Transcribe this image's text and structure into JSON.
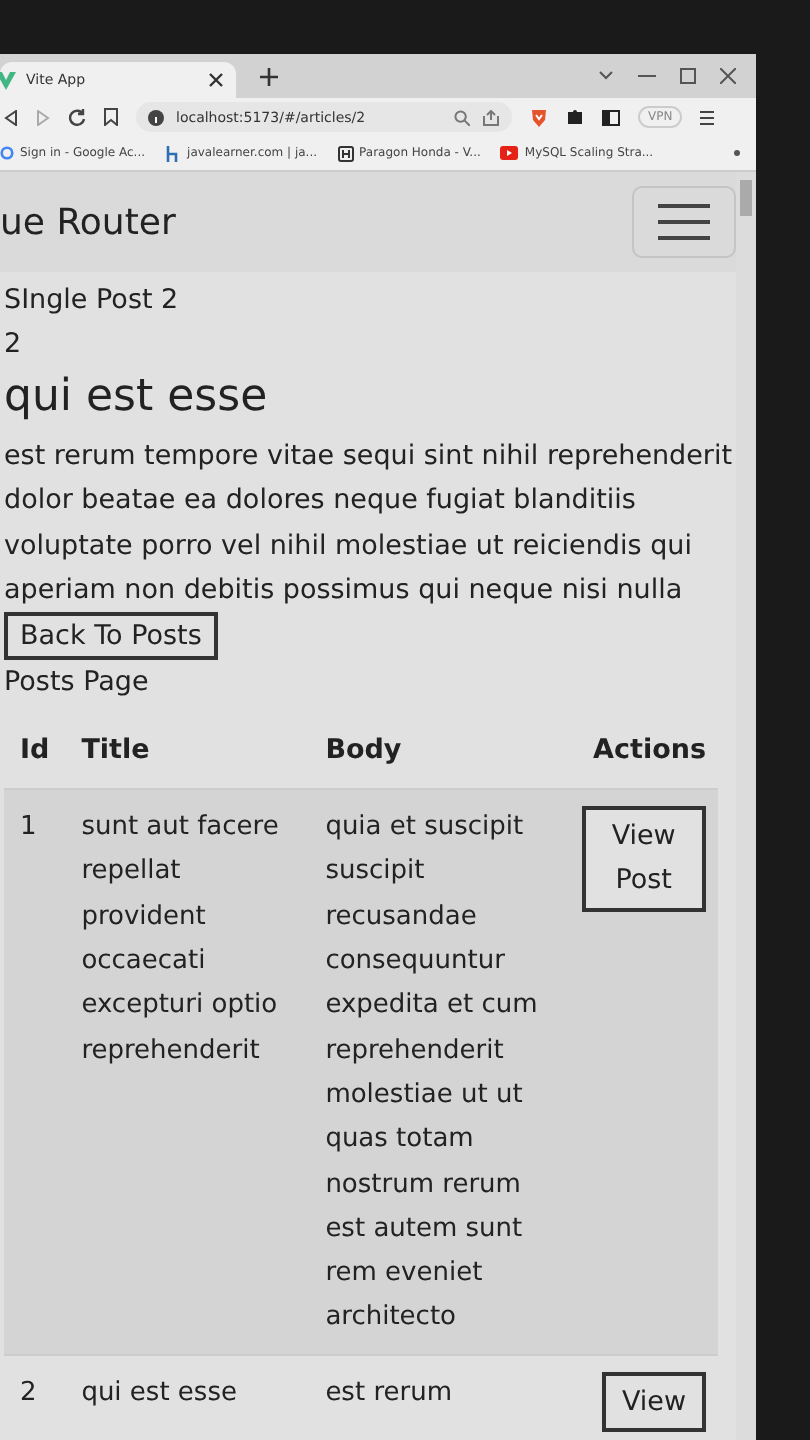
{
  "browser": {
    "tab": {
      "title": "Vite App",
      "selected": true
    },
    "url": "localhost:5173/#/articles/2",
    "vpn": "VPN",
    "bookmarks": [
      {
        "label": "Sign in - Google Ac...",
        "kind": "google"
      },
      {
        "label": "javalearner.com | ja...",
        "kind": "site"
      },
      {
        "label": "Paragon Honda - V...",
        "kind": "honda"
      },
      {
        "label": "MySQL Scaling Stra...",
        "kind": "video"
      }
    ]
  },
  "navbar": {
    "brand": "ue Router"
  },
  "post": {
    "heading": "SIngle Post 2",
    "id": "2",
    "title": "qui est esse",
    "body": "est rerum tempore vitae sequi sint nihil reprehenderit dolor beatae ea dolores neque fugiat blanditiis voluptate porro vel nihil molestiae ut reiciendis qui aperiam non debitis possimus qui neque nisi nulla",
    "back_button": "Back To Posts"
  },
  "posts_page": {
    "label": "Posts Page",
    "table": {
      "columns": [
        "Id",
        "Title",
        "Body",
        "Actions"
      ],
      "rows": [
        {
          "id": "1",
          "title": "sunt aut facere repellat provident occaecati excepturi optio reprehenderit",
          "body": "quia et suscipit suscipit recusandae consequuntur expedita et cum reprehenderit molestiae ut ut quas totam nostrum rerum est autem sunt rem eveniet architecto",
          "action": "View Post"
        },
        {
          "id": "2",
          "title": "qui est esse",
          "body": "est rerum",
          "action": "View"
        }
      ]
    }
  }
}
